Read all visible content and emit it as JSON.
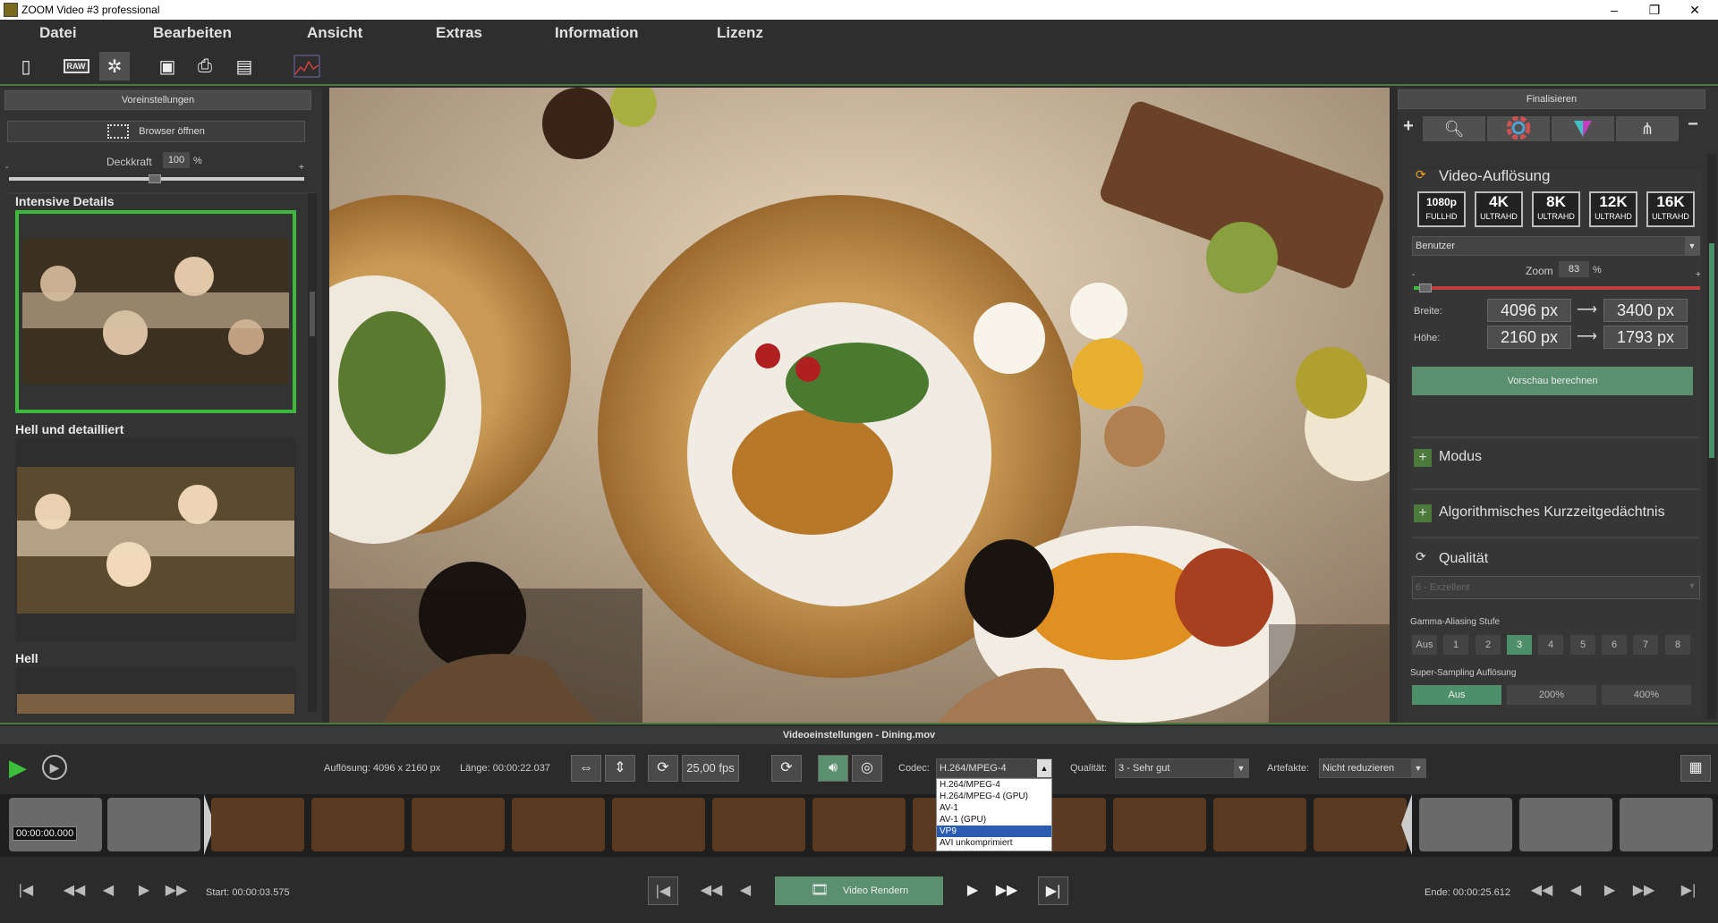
{
  "window": {
    "title": "ZOOM Video #3 professional"
  },
  "menu": [
    "Datei",
    "Bearbeiten",
    "Ansicht",
    "Extras",
    "Information",
    "Lizenz"
  ],
  "toolbar": {
    "icons": [
      "new-file-icon",
      "raw-icon",
      "settings-icon",
      "save-icon",
      "print-icon",
      "batch-icon",
      "histogram-icon"
    ],
    "raw_label": "RAW"
  },
  "left": {
    "header": "Voreinstellungen",
    "browser_button": "Browser öffnen",
    "opacity_label": "Deckkraft",
    "opacity_value": "100",
    "opacity_unit": "%",
    "slider_min": "-",
    "slider_max": "+",
    "presets": [
      "Intensive Details",
      "Hell und detailliert",
      "Hell"
    ]
  },
  "right": {
    "header": "Finalisieren",
    "add": "+",
    "remove": "−",
    "resolution_title": "Video-Auflösung",
    "res_buttons": [
      {
        "big": "1080p",
        "small": "FULLHD"
      },
      {
        "big": "4K",
        "small": "ULTRAHD"
      },
      {
        "big": "8K",
        "small": "ULTRAHD"
      },
      {
        "big": "12K",
        "small": "ULTRAHD"
      },
      {
        "big": "16K",
        "small": "ULTRAHD"
      }
    ],
    "preset_select": "Benutzer",
    "zoom_label": "Zoom",
    "zoom_value": "83",
    "zoom_unit": "%",
    "zoom_min": "-",
    "zoom_max": "+",
    "zoom_level": 0.02,
    "width_label": "Breite:",
    "height_label": "Höhe:",
    "width_src": "4096 px",
    "width_dst": "3400 px",
    "height_src": "2160 px",
    "height_dst": "1793 px",
    "arrow": "⟶",
    "preview_button": "Vorschau berechnen",
    "modus": "Modus",
    "algo": "Algorithmisches Kurzzeitgedächtnis",
    "quality_title": "Qualität",
    "quality_select": "6 - Exzellent",
    "gamma_label": "Gamma-Aliasing Stufe",
    "gamma_buttons": [
      "Aus",
      "1",
      "2",
      "3",
      "4",
      "5",
      "6",
      "7",
      "8"
    ],
    "ss_label": "Super-Sampling Auflösung",
    "ss_buttons": [
      "Aus",
      "200%",
      "400%"
    ]
  },
  "bottom": {
    "title": "Videoeinstellungen - Dining.mov",
    "resolution": "Auflösung: 4096 x 2160 px",
    "length": "Länge: 00:00:22.037",
    "fps": "25,00 fps",
    "codec_label": "Codec:",
    "codec_value": "H.264/MPEG-4",
    "codec_options": [
      "H.264/MPEG-4",
      "H.264/MPEG-4 (GPU)",
      "AV-1",
      "AV-1 (GPU)",
      "VP9",
      "AVI unkomprimiert"
    ],
    "quality_label": "Qualität:",
    "quality_value": "3 - Sehr gut",
    "artifacts_label": "Artefakte:",
    "artifacts_value": "Nicht reduzieren",
    "timecode": "00:00:00.000",
    "start": "Start: 00:00:03.575",
    "end": "Ende: 00:00:25.612",
    "render_button": "Video Rendern"
  }
}
